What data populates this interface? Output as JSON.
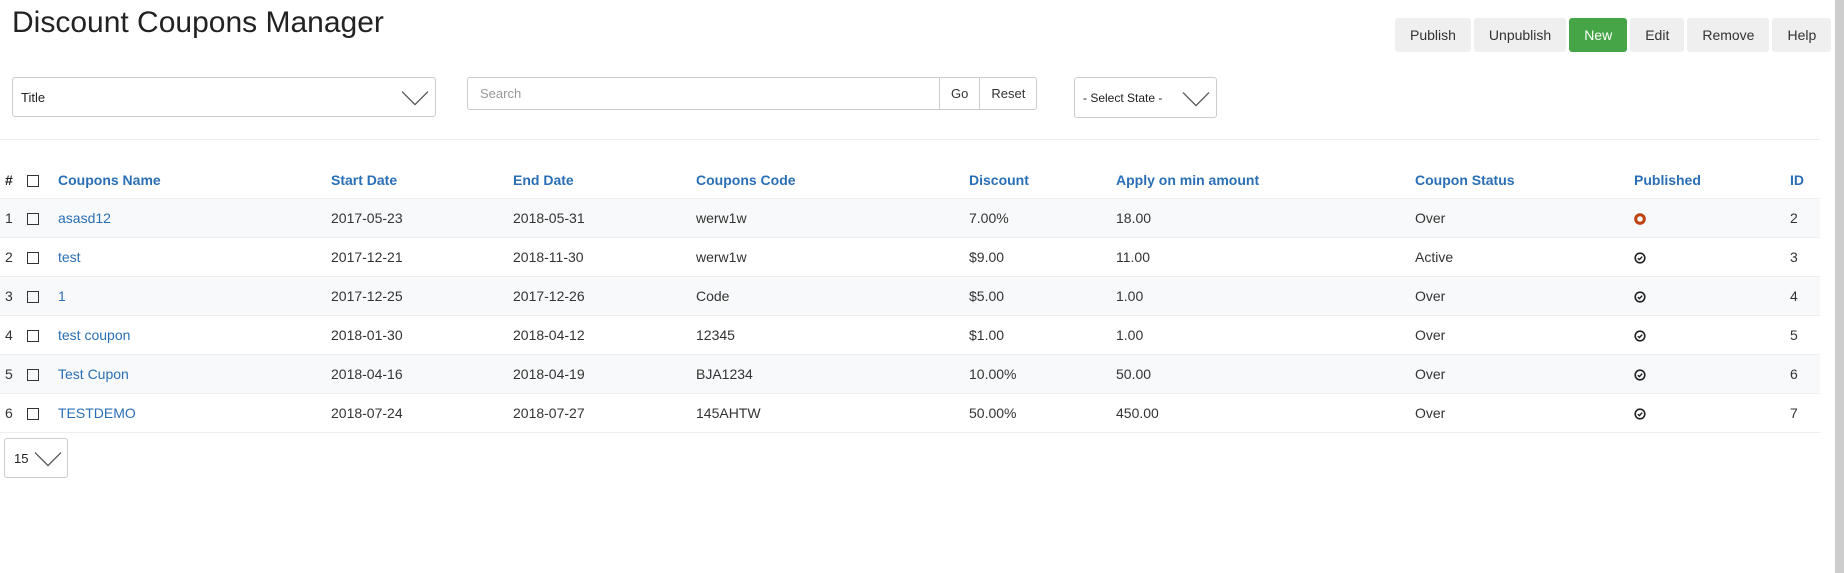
{
  "page": {
    "title": "Discount Coupons Manager"
  },
  "toolbar": {
    "buttons": [
      {
        "label": "Publish"
      },
      {
        "label": "Unpublish"
      },
      {
        "label": "New"
      },
      {
        "label": "Edit"
      },
      {
        "label": "Remove"
      },
      {
        "label": "Help"
      }
    ],
    "primary_color": "#46a546"
  },
  "filters": {
    "field_select": {
      "value": "Title"
    },
    "search": {
      "placeholder": "Search",
      "value": "",
      "go_label": "Go",
      "reset_label": "Reset"
    },
    "state_select": {
      "value": "- Select State -"
    }
  },
  "table": {
    "headers": {
      "num": "#",
      "name": "Coupons Name",
      "start": "Start Date",
      "end": "End Date",
      "code": "Coupons Code",
      "discount": "Discount",
      "min_amount": "Apply on min amount",
      "status": "Coupon Status",
      "published": "Published",
      "id": "ID"
    },
    "rows": [
      {
        "num": "1",
        "name": "asasd12",
        "start": "2017-05-23",
        "end": "2018-05-31",
        "code": "werw1w",
        "discount": "7.00%",
        "min_amount": "18.00",
        "status": "Over",
        "published": "unpublished",
        "id": "2"
      },
      {
        "num": "2",
        "name": "test",
        "start": "2017-12-21",
        "end": "2018-11-30",
        "code": "werw1w",
        "discount": "$9.00",
        "min_amount": "11.00",
        "status": "Active",
        "published": "published",
        "id": "3"
      },
      {
        "num": "3",
        "name": "1",
        "start": "2017-12-25",
        "end": "2017-12-26",
        "code": "Code",
        "discount": "$5.00",
        "min_amount": "1.00",
        "status": "Over",
        "published": "published",
        "id": "4"
      },
      {
        "num": "4",
        "name": "test coupon",
        "start": "2018-01-30",
        "end": "2018-04-12",
        "code": "12345",
        "discount": "$1.00",
        "min_amount": "1.00",
        "status": "Over",
        "published": "published",
        "id": "5"
      },
      {
        "num": "5",
        "name": "Test Cupon",
        "start": "2018-04-16",
        "end": "2018-04-19",
        "code": "BJA1234",
        "discount": "10.00%",
        "min_amount": "50.00",
        "status": "Over",
        "published": "published",
        "id": "6"
      },
      {
        "num": "6",
        "name": "TESTDEMO",
        "start": "2018-07-24",
        "end": "2018-07-27",
        "code": "145AHTW",
        "discount": "50.00%",
        "min_amount": "450.00",
        "status": "Over",
        "published": "published",
        "id": "7"
      }
    ]
  },
  "pagination": {
    "per_page": "15"
  },
  "colors": {
    "link": "#2a6fb5",
    "unpublished_icon": "#c0410e",
    "published_icon": "#222222"
  }
}
